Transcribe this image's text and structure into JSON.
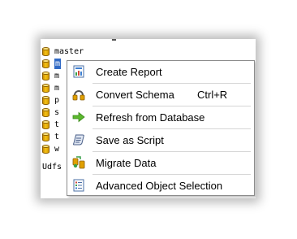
{
  "tree": {
    "items": [
      {
        "label": "master",
        "selected": false
      },
      {
        "label": "m",
        "selected": true
      },
      {
        "label": "m",
        "selected": false
      },
      {
        "label": "m",
        "selected": false
      },
      {
        "label": "p",
        "selected": false
      },
      {
        "label": "s",
        "selected": false
      },
      {
        "label": "t",
        "selected": false
      },
      {
        "label": "t",
        "selected": false
      },
      {
        "label": "w",
        "selected": false
      }
    ],
    "udfs_label": "Udfs"
  },
  "context_menu": {
    "items": [
      {
        "label": "Create Report",
        "icon": "report-icon",
        "shortcut": ""
      },
      {
        "label": "Convert Schema",
        "icon": "convert-schema-icon",
        "shortcut": "Ctrl+R"
      },
      {
        "label": "Refresh from Database",
        "icon": "refresh-arrow-icon",
        "shortcut": ""
      },
      {
        "label": "Save as Script",
        "icon": "save-script-icon",
        "shortcut": ""
      },
      {
        "label": "Migrate Data",
        "icon": "migrate-data-icon",
        "shortcut": ""
      },
      {
        "label": "Advanced Object Selection",
        "icon": "object-selection-icon",
        "shortcut": ""
      }
    ]
  },
  "colors": {
    "selection": "#316ac5",
    "menu_border": "#8c8c8c",
    "separator": "#d6d6d6",
    "refresh_arrow": "#5cb82e",
    "db_icon": "#f4c316"
  }
}
